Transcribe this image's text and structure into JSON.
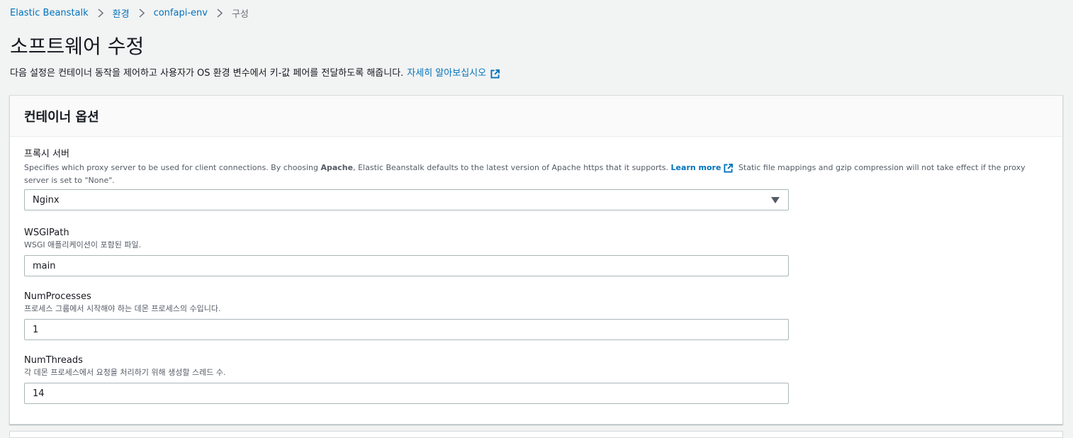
{
  "breadcrumb": {
    "items": [
      "Elastic Beanstalk",
      "환경",
      "confapi-env"
    ],
    "current": "구성"
  },
  "page": {
    "title": "소프트웨어 수정",
    "description": "다음 설정은 컨테이너 동작을 제어하고 사용자가 OS 환경 변수에서 키-값 페어를 전달하도록 해줍니다.",
    "learn_more": "자세히 알아보십시오"
  },
  "panel": {
    "title": "컨테이너 옵션"
  },
  "fields": {
    "proxy": {
      "label": "프록시 서버",
      "desc_before": "Specifies which proxy server to be used for client connections. By choosing ",
      "desc_bold": "Apache",
      "desc_middle": ", Elastic Beanstalk defaults to the latest version of Apache https that it supports. ",
      "desc_link": "Learn more",
      "desc_after": " Static file mappings and gzip compression will not take effect if the proxy server is set to \"None\".",
      "value": "Nginx"
    },
    "wsgi_path": {
      "label": "WSGIPath",
      "desc": "WSGI 애플리케이션이 포함된 파일.",
      "value": "main"
    },
    "num_processes": {
      "label": "NumProcesses",
      "desc": "프로세스 그룹에서 시작해야 하는 데몬 프로세스의 수입니다.",
      "value": "1"
    },
    "num_threads": {
      "label": "NumThreads",
      "desc": "각 데몬 프로세스에서 요청을 처리하기 위해 생성할 스레드 수.",
      "value": "14"
    }
  },
  "icons": {
    "breadcrumb_separator": "chevron-right-icon",
    "external_link": "external-link-icon",
    "select_caret": "caret-down-icon"
  },
  "colors": {
    "link": "#0073bb",
    "background": "#f2f3f3",
    "text": "#16191f",
    "muted": "#545b64"
  }
}
